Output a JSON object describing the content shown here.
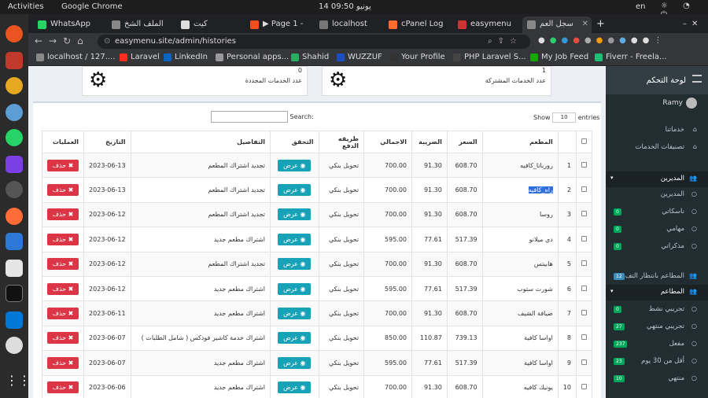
{
  "os": {
    "activities": "Activities",
    "app": "Google Chrome",
    "clock": "14 يونيو  09:50",
    "lang": "en"
  },
  "tabs": [
    {
      "title": "WhatsApp",
      "color": "#25d366"
    },
    {
      "title": "الملف الشخ",
      "color": "#888888"
    },
    {
      "title": "كيت",
      "color": "#dddddd"
    },
    {
      "title": "▶ Page 1 -",
      "color": "#f24e1e"
    },
    {
      "title": "localhost",
      "color": "#777777"
    },
    {
      "title": "cPanel Log",
      "color": "#ff6c2c"
    },
    {
      "title": "easymenu",
      "color": "#cc3333"
    },
    {
      "title": "سجل العم",
      "color": "#888888"
    }
  ],
  "address": {
    "url": "easymenu.site/admin/histories"
  },
  "bookmarks": [
    {
      "label": "localhost / 127....",
      "color": "#888888"
    },
    {
      "label": "Laravel",
      "color": "#ff2d20"
    },
    {
      "label": "LinkedIn",
      "color": "#0a66c2"
    },
    {
      "label": "Personal apps...",
      "color": "#999999"
    },
    {
      "label": "Shahid",
      "color": "#27ae60"
    },
    {
      "label": "WUZZUF",
      "color": "#1a4fc4"
    },
    {
      "label": "Your Profile",
      "color": "#333333"
    },
    {
      "label": "PHP Laravel S...",
      "color": "#444444"
    },
    {
      "label": "My Job Feed",
      "color": "#14a800"
    },
    {
      "label": "Fiverr - Freela...",
      "color": "#1dbf73"
    }
  ],
  "stats": [
    {
      "num": "1",
      "label": "عدد الخدمات المشتركة"
    },
    {
      "num": "0",
      "label": "عدد الخدمات المجددة"
    }
  ],
  "table": {
    "show": "Show",
    "entries_value": "10",
    "entries": "entries",
    "search_label": "Search:",
    "headers": [
      "",
      "",
      "المطعم",
      "السعر",
      "الضريبة",
      "الاجمالي",
      "طريقه الدفع",
      "التحقق",
      "التفاصيل",
      "التاريخ",
      "العمليات"
    ],
    "view_label": "عرض",
    "delete_label": "حذف",
    "rows": [
      {
        "n": "1",
        "restaurant": "روربانا_كافيه",
        "price": "608.70",
        "tax": "91.30",
        "total": "700.00",
        "pay": "تحويل بنكي",
        "details": "تجديد اشتراك المطعم",
        "date": "2023-06-13"
      },
      {
        "n": "2",
        "restaurant": "راه_كافيه",
        "price": "608.70",
        "tax": "91.30",
        "total": "700.00",
        "pay": "تحويل بنكي",
        "details": "تجديد اشتراك المطعم",
        "date": "2023-06-13"
      },
      {
        "n": "3",
        "restaurant": "روسا",
        "price": "608.70",
        "tax": "91.30",
        "total": "700.00",
        "pay": "تحويل بنكي",
        "details": "تجديد اشتراك المطعم",
        "date": "2023-06-12"
      },
      {
        "n": "4",
        "restaurant": "دي ميلانو",
        "price": "517.39",
        "tax": "77.61",
        "total": "595.00",
        "pay": "تحويل بنكي",
        "details": "اشتراك مطعم جديد",
        "date": "2023-06-12"
      },
      {
        "n": "5",
        "restaurant": "هابيتس",
        "price": "608.70",
        "tax": "91.30",
        "total": "700.00",
        "pay": "تحويل بنكي",
        "details": "تجديد اشتراك المطعم",
        "date": "2023-06-12"
      },
      {
        "n": "6",
        "restaurant": "شورت ستوب",
        "price": "517.39",
        "tax": "77.61",
        "total": "595.00",
        "pay": "تحويل بنكي",
        "details": "اشتراك مطعم جديد",
        "date": "2023-06-12"
      },
      {
        "n": "7",
        "restaurant": "ضيافة الشيف",
        "price": "608.70",
        "tax": "91.30",
        "total": "700.00",
        "pay": "تحويل بنكي",
        "details": "اشتراك مطعم جديد",
        "date": "2023-06-11"
      },
      {
        "n": "8",
        "restaurant": "اواسا كافية",
        "price": "739.13",
        "tax": "110.87",
        "total": "850.00",
        "pay": "تحويل بنكي",
        "details": "اشتراك خدمة كاشير فودكس ( شامل الطلبات )",
        "date": "2023-06-07"
      },
      {
        "n": "9",
        "restaurant": "اواسا كافية",
        "price": "517.39",
        "tax": "77.61",
        "total": "595.00",
        "pay": "تحويل بنكي",
        "details": "اشتراك مطعم جديد",
        "date": "2023-06-07"
      },
      {
        "n": "10",
        "restaurant": "يونيك كافيه",
        "price": "608.70",
        "tax": "91.30",
        "total": "700.00",
        "pay": "تحويل بنكي",
        "details": "اشتراك مطعم جديد",
        "date": "2023-06-06"
      }
    ]
  },
  "sidebar": {
    "title": "لوحة التحكم",
    "user": "Ramy",
    "items": [
      {
        "label": "خدماتنا",
        "badge": ""
      },
      {
        "label": "تصنيفات الخدمات",
        "badge": ""
      },
      {
        "label": "المديرين",
        "badge": ""
      },
      {
        "label": "المديرين",
        "badge": ""
      },
      {
        "label": "ناسكاتي",
        "badge": "0"
      },
      {
        "label": "مهامي",
        "badge": "0"
      },
      {
        "label": "مذكراتي",
        "badge": "0"
      },
      {
        "label": "المطاعم بانتظار التف",
        "badge": "12"
      },
      {
        "label": "المطاعم",
        "badge": ""
      },
      {
        "label": "تجريبي نشط",
        "badge": "0"
      },
      {
        "label": "تجريبي منتهي",
        "badge": "27"
      },
      {
        "label": "مفعل",
        "badge": "237"
      },
      {
        "label": "أقل من 30 يوم",
        "badge": "23"
      },
      {
        "label": "منتهي",
        "badge": "10"
      }
    ]
  }
}
